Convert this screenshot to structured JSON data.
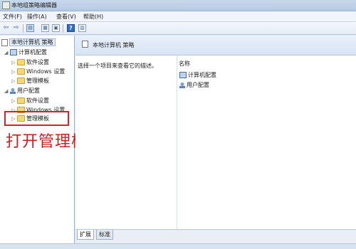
{
  "window": {
    "title": "本地组策略编辑器"
  },
  "menu": [
    "文件(F)",
    "操作(A)",
    "查看(V)",
    "帮助(H)"
  ],
  "toolbar": {
    "back": "⇦",
    "forward": "⇨",
    "help": "?"
  },
  "tree": {
    "root": "本地计算机 策略",
    "computer": "计算机配置",
    "computer_children": [
      "软件设置",
      "Windows 设置",
      "管理模板"
    ],
    "user": "用户配置",
    "user_children": [
      "软件设置",
      "Windows 设置",
      "管理模板"
    ]
  },
  "annotation": "打开管理模板",
  "details": {
    "header": "本地计算机 策略",
    "description": "选择一个项目来查看它的描述。",
    "column": "名称",
    "items": [
      "计算机配置",
      "用户配置"
    ]
  },
  "tabs": [
    "扩展",
    "标准"
  ],
  "colors": {
    "annotation": "#c6201e",
    "highlight_box": "#d4242a"
  }
}
